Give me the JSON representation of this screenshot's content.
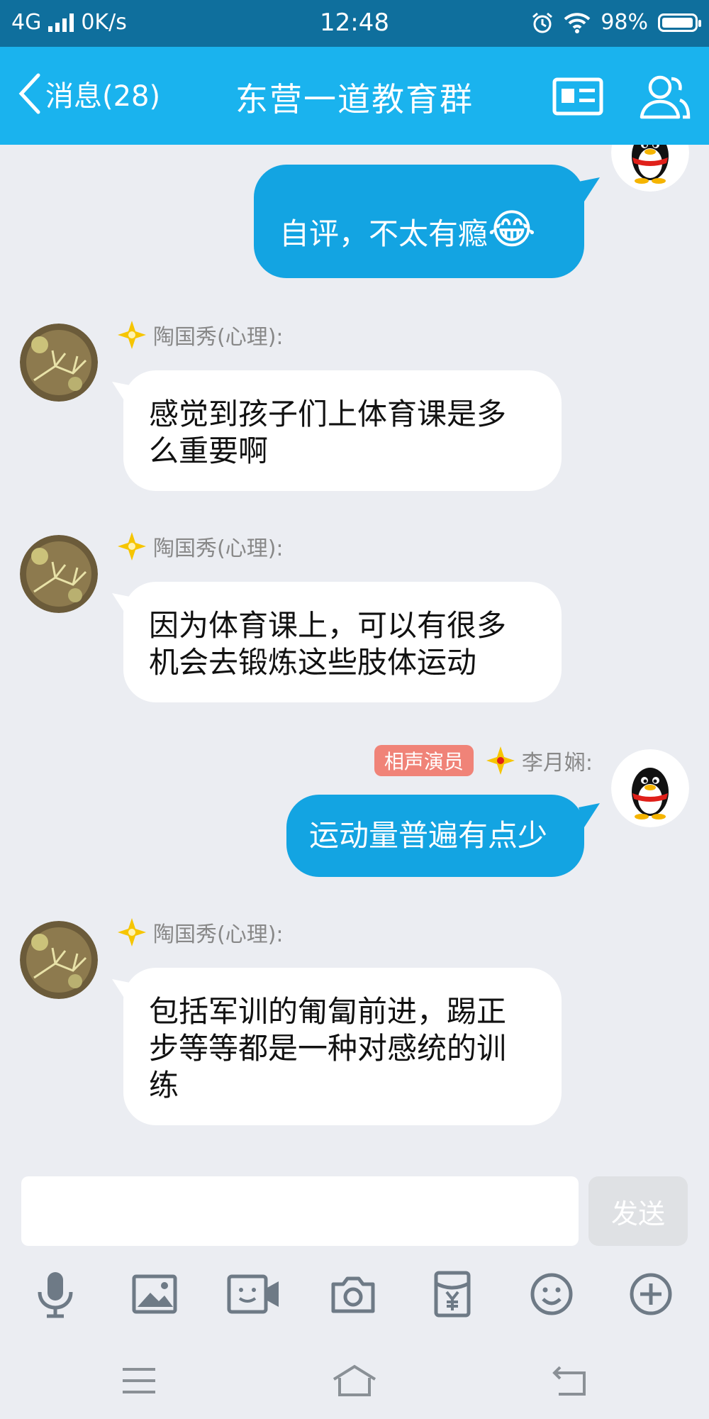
{
  "status_bar": {
    "network": "4G",
    "speed": "0K/s",
    "time": "12:48",
    "battery": "98%",
    "battery_level": 0.98
  },
  "header": {
    "back_label": "消息(28)",
    "title": "东营一道教育群"
  },
  "messages": [
    {
      "direction": "out",
      "text": "自评，不太有瘾",
      "emoji": "😂"
    },
    {
      "direction": "in",
      "sender": "陶国秀(心理):",
      "lines": [
        "感觉到孩子们上体育课是多",
        "么重要啊"
      ]
    },
    {
      "direction": "in",
      "sender": "陶国秀(心理):",
      "lines": [
        "因为体育课上，可以有很多",
        "机会去锻炼这些肢体运动"
      ]
    },
    {
      "direction": "out",
      "tag": "相声演员",
      "sender": "李月娴:",
      "text": "运动量普遍有点少"
    },
    {
      "direction": "in",
      "sender": "陶国秀(心理):",
      "lines": [
        "包括军训的匍匐前进，踢正",
        "步等等都是一种对感统的训",
        "练"
      ]
    }
  ],
  "input": {
    "placeholder": "",
    "send_label": "发送"
  },
  "colors": {
    "status_bar": "#0f6f9d",
    "title_bar": "#1ab3ee",
    "outgoing_bubble": "#13a4e2",
    "incoming_bubble": "#ffffff",
    "chat_background": "#ebedf2",
    "tag": "#f08378"
  },
  "icons": {
    "toolbar": [
      "microphone-icon",
      "image-icon",
      "video-call-icon",
      "camera-icon",
      "red-packet-icon",
      "emoji-icon",
      "plus-icon"
    ],
    "navbar": [
      "menu-icon",
      "home-icon",
      "back-icon"
    ],
    "header": [
      "profile-card-icon",
      "group-members-icon"
    ]
  }
}
